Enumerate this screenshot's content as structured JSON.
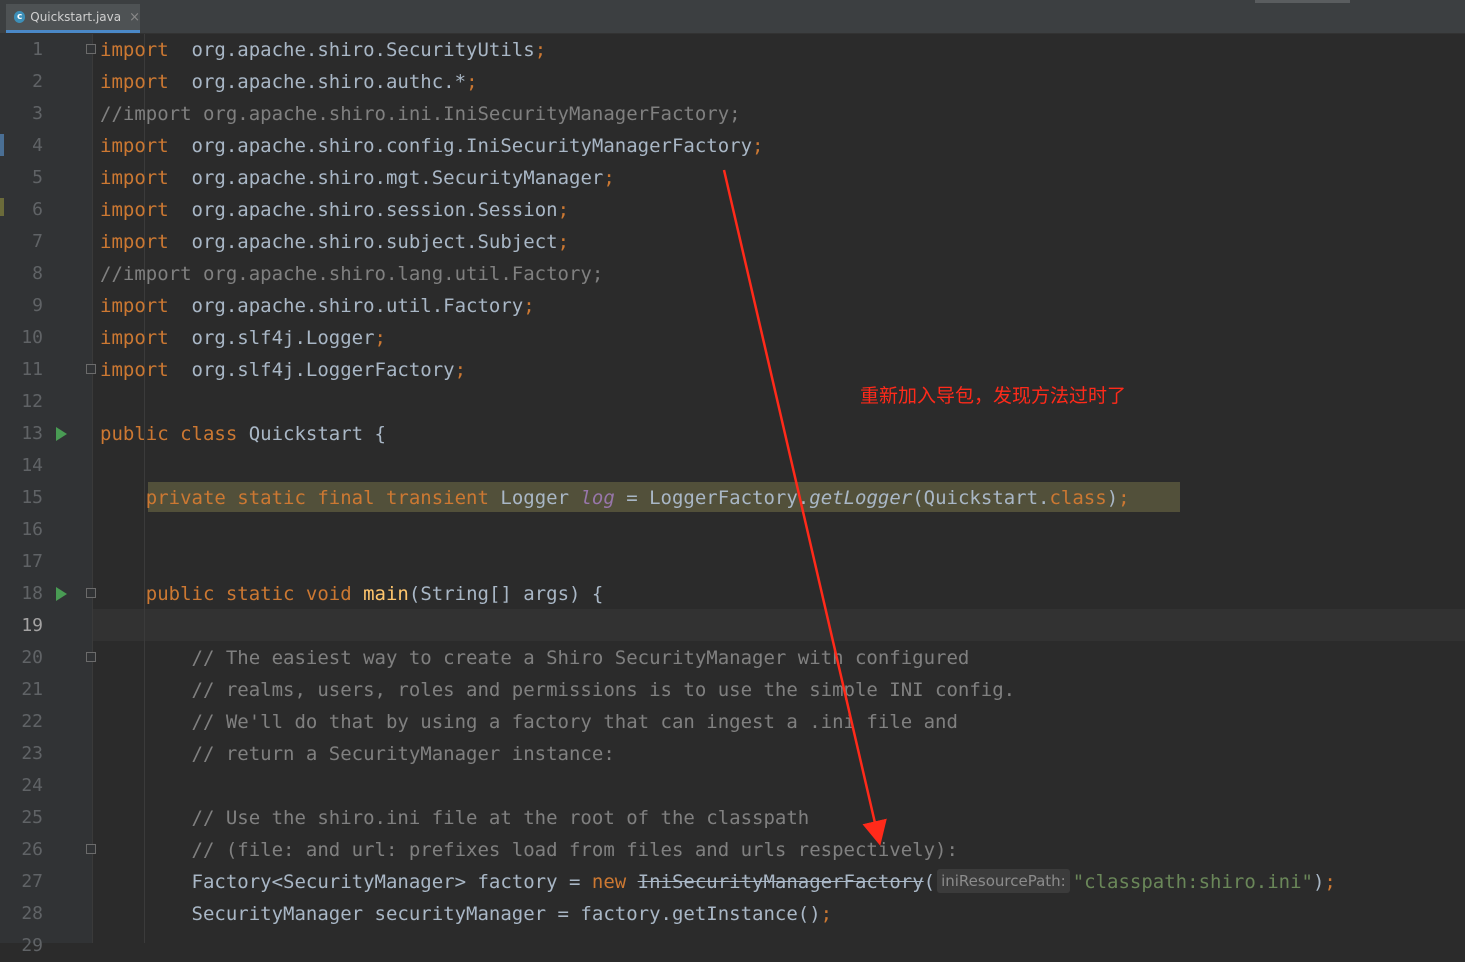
{
  "editor": {
    "tab": {
      "icon": "class-file-icon",
      "label": "Quickstart.java",
      "close": "×"
    },
    "current_line": 19,
    "lines": [
      {
        "n": 1,
        "segs": [
          [
            "kw",
            "import"
          ],
          [
            "",
            "  org.apache.shiro.SecurityUtils"
          ],
          [
            "kw",
            ";"
          ]
        ]
      },
      {
        "n": 2,
        "segs": [
          [
            "kw",
            "import"
          ],
          [
            "",
            "  org.apache.shiro.authc.*"
          ],
          [
            "kw",
            ";"
          ]
        ]
      },
      {
        "n": 3,
        "segs": [
          [
            "cmt",
            "//import org.apache.shiro.ini.IniSecurityManagerFactory;"
          ]
        ]
      },
      {
        "n": 4,
        "segs": [
          [
            "kw",
            "import"
          ],
          [
            "",
            "  org.apache.shiro.config.IniSecurityManagerFactory"
          ],
          [
            "kw",
            ";"
          ]
        ]
      },
      {
        "n": 5,
        "segs": [
          [
            "kw",
            "import"
          ],
          [
            "",
            "  org.apache.shiro.mgt.SecurityManager"
          ],
          [
            "kw",
            ";"
          ]
        ]
      },
      {
        "n": 6,
        "segs": [
          [
            "kw",
            "import"
          ],
          [
            "",
            "  org.apache.shiro.session.Session"
          ],
          [
            "kw",
            ";"
          ]
        ]
      },
      {
        "n": 7,
        "segs": [
          [
            "kw",
            "import"
          ],
          [
            "",
            "  org.apache.shiro.subject.Subject"
          ],
          [
            "kw",
            ";"
          ]
        ]
      },
      {
        "n": 8,
        "segs": [
          [
            "cmt",
            "//import org.apache.shiro.lang.util.Factory;"
          ]
        ]
      },
      {
        "n": 9,
        "segs": [
          [
            "kw",
            "import"
          ],
          [
            "",
            "  org.apache.shiro.util.Factory"
          ],
          [
            "kw",
            ";"
          ]
        ]
      },
      {
        "n": 10,
        "segs": [
          [
            "kw",
            "import"
          ],
          [
            "",
            "  org.slf4j.Logger"
          ],
          [
            "kw",
            ";"
          ]
        ]
      },
      {
        "n": 11,
        "segs": [
          [
            "kw",
            "import"
          ],
          [
            "",
            "  org.slf4j.LoggerFactory"
          ],
          [
            "kw",
            ";"
          ]
        ]
      },
      {
        "n": 12,
        "segs": []
      },
      {
        "n": 13,
        "segs": [
          [
            "kw",
            "public class "
          ],
          [
            "",
            "Quickstart {"
          ]
        ]
      },
      {
        "n": 14,
        "segs": []
      },
      {
        "n": 15,
        "segs": [
          [
            "",
            "    "
          ],
          [
            "kw",
            "private static final transient "
          ],
          [
            "",
            "Logger "
          ],
          [
            "fld",
            "log"
          ],
          [
            "",
            " = LoggerFactory."
          ],
          [
            "ital",
            "getLogger"
          ],
          [
            "",
            "(Quickstart."
          ],
          [
            "kw",
            "class"
          ],
          [
            "",
            ")"
          ],
          [
            "kw",
            ";"
          ]
        ]
      },
      {
        "n": 16,
        "segs": []
      },
      {
        "n": 17,
        "segs": []
      },
      {
        "n": 18,
        "segs": [
          [
            "",
            "    "
          ],
          [
            "kw",
            "public static void "
          ],
          [
            "fn",
            "main"
          ],
          [
            "",
            "(String[] args) {"
          ]
        ]
      },
      {
        "n": 19,
        "segs": []
      },
      {
        "n": 20,
        "segs": [
          [
            "cmt",
            "        // The easiest way to create a Shiro SecurityManager with configured"
          ]
        ]
      },
      {
        "n": 21,
        "segs": [
          [
            "cmt",
            "        // realms, users, roles and permissions is to use the simple INI config."
          ]
        ]
      },
      {
        "n": 22,
        "segs": [
          [
            "cmt",
            "        // We'll do that by using a factory that can ingest a .ini file and"
          ]
        ]
      },
      {
        "n": 23,
        "segs": [
          [
            "cmt",
            "        // return a SecurityManager instance:"
          ]
        ]
      },
      {
        "n": 24,
        "segs": []
      },
      {
        "n": 25,
        "segs": [
          [
            "cmt",
            "        // Use the shiro.ini file at the root of the classpath"
          ]
        ]
      },
      {
        "n": 26,
        "segs": [
          [
            "cmt",
            "        // (file: and url: prefixes load from files and urls respectively):"
          ]
        ]
      },
      {
        "n": 27,
        "segs": [
          [
            "",
            "        Factory<SecurityManager> factory = "
          ],
          [
            "kw",
            "new "
          ],
          [
            "dep",
            "IniSecurityManagerFactory"
          ],
          [
            "",
            "("
          ],
          [
            "hint",
            "iniResourcePath:"
          ],
          [
            "str",
            "\"classpath:shiro.ini\""
          ],
          [
            "",
            ")"
          ],
          [
            "kw",
            ";"
          ]
        ]
      },
      {
        "n": 28,
        "segs": [
          [
            "",
            "        SecurityManager securityManager = factory.getInstance()"
          ],
          [
            "kw",
            ";"
          ]
        ]
      },
      {
        "n": 29,
        "segs": []
      }
    ],
    "run_lines": [
      13,
      18
    ],
    "fold_lines": [
      1,
      11,
      18,
      20,
      26
    ]
  },
  "annotation": {
    "text": "重新加入导包，发现方法过时了",
    "color": "#ff2a1a"
  },
  "colors": {
    "background": "#2b2b2b",
    "keyword": "#cc7832",
    "comment": "#808080",
    "string": "#6a8759",
    "field": "#9876aa",
    "method_decl": "#ffc66d"
  }
}
